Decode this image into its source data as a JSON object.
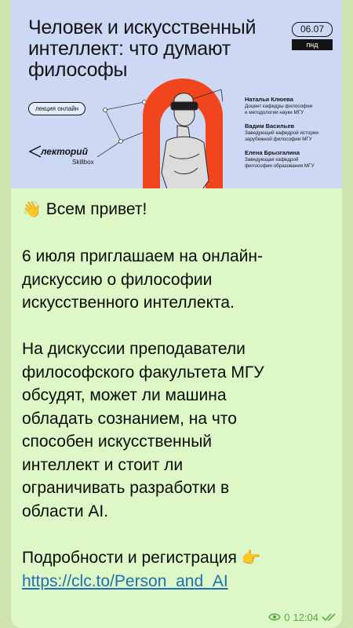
{
  "poster": {
    "title": "Человек и искусственный\nинтеллект: что думают\nфилософы",
    "date": "06.07",
    "weekday": "пнд",
    "tag": "лекция онлайн",
    "logo_main": "лекторий",
    "logo_sub": "Skillbox",
    "speakers": [
      {
        "name": "Наталья Клюева",
        "role": "Доцент кафедры философии\nи методологии науки МГУ"
      },
      {
        "name": "Вадим Васильев",
        "role": "Заведующий кафедрой истории\nзарубежной философии МГУ"
      },
      {
        "name": "Елена Брызгалина",
        "role": "Заведующая кафедрой\nфилософии образования МГУ"
      }
    ]
  },
  "message": {
    "greeting_emoji": "👋",
    "greeting": "Всем привет!",
    "paragraph1": "6 июля приглашаем на онлайн-\nдискуссию о философии\nискусственного интеллекта.",
    "paragraph2": "На дискуссии преподаватели\nфилософского факультета МГУ\nобсудят, может ли машина\nобладать сознанием, на что\nспособен искусственный\nинтеллект и стоит ли\nограничивать разработки в\nобласти AI.",
    "details": "Подробности и регистрация",
    "details_emoji": "👉",
    "link": "https://clc.to/Person_and_AI"
  },
  "meta": {
    "views": "0",
    "time": "12:04",
    "eye_icon": "eye-icon",
    "read_icon": "double-check-icon",
    "accent": "#5aa84a"
  }
}
